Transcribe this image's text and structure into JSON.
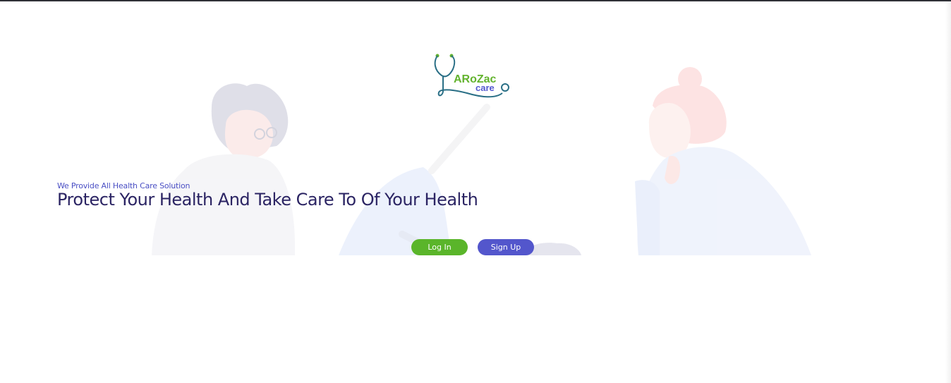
{
  "logo": {
    "primary_text": "ARoZac",
    "secondary_text": "care",
    "icon": "stethoscope-icon",
    "colors": {
      "green": "#63b32e",
      "blue": "#5358cf",
      "teal": "#2a6f86"
    }
  },
  "hero": {
    "tagline": "We Provide All Health Care Solution",
    "headline": "Protect Your Health And Take Care To Of Your Health",
    "illustration": "healthcare-people-illustration"
  },
  "actions": {
    "login_label": "Log In",
    "signup_label": "Sign Up"
  },
  "colors": {
    "login_button": "#5ab52a",
    "signup_button": "#5356cc",
    "headline": "#2b2463",
    "tagline": "#4a4fc4"
  }
}
